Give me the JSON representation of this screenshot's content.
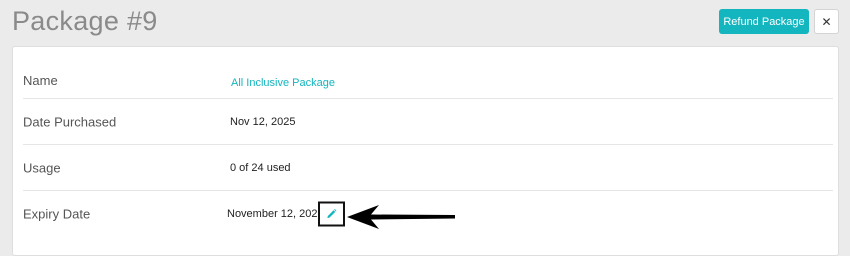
{
  "header": {
    "title": "Package #9",
    "refund_label": "Refund Package",
    "close_glyph": "✕"
  },
  "details": {
    "rows": [
      {
        "label": "Name",
        "value": "All Inclusive Package"
      },
      {
        "label": "Date Purchased",
        "value": "Nov 12, 2025"
      },
      {
        "label": "Usage",
        "value": "0 of 24 used"
      },
      {
        "label": "Expiry Date",
        "value": "November 12, 2025"
      }
    ]
  },
  "icons": {
    "close": "close-icon",
    "edit": "pencil-icon",
    "annotation": "arrow-left-icon"
  },
  "colors": {
    "accent": "#13b5bf",
    "page_background": "#ebebeb",
    "card_background": "#ffffff",
    "title": "#8a8a8a"
  }
}
